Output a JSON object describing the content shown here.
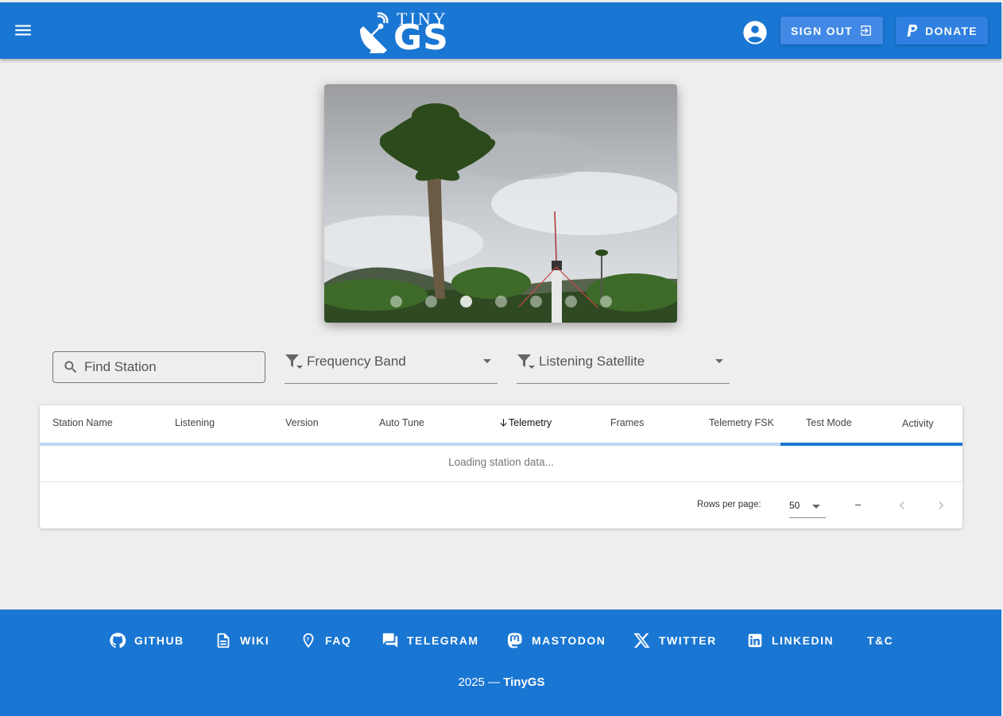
{
  "header": {
    "logo_top": "TINY",
    "logo_main": "GS",
    "sign_out_label": "SIGN OUT",
    "donate_label": "DONATE"
  },
  "carousel": {
    "slide_count": 7,
    "active_slide": 3
  },
  "filters": {
    "search_placeholder": "Find Station",
    "frequency_band_label": "Frequency Band",
    "listening_satellite_label": "Listening Satellite"
  },
  "table": {
    "columns": [
      {
        "label": "Station Name"
      },
      {
        "label": "Listening"
      },
      {
        "label": "Version"
      },
      {
        "label": "Auto Tune"
      },
      {
        "label": "Telemetry",
        "sorted": "desc"
      },
      {
        "label": "Frames"
      },
      {
        "label": "Telemetry FSK"
      },
      {
        "label": "Test Mode"
      },
      {
        "label": "Activity"
      }
    ],
    "loading_text": "Loading station data...",
    "rows_per_page_label": "Rows per page:",
    "rows_per_page_value": "50",
    "range_text": "–"
  },
  "footer": {
    "links": [
      {
        "label": "GITHUB",
        "icon": "github-icon"
      },
      {
        "label": "WIKI",
        "icon": "document-icon"
      },
      {
        "label": "FAQ",
        "icon": "help-location-icon"
      },
      {
        "label": "TELEGRAM",
        "icon": "chat-icon"
      },
      {
        "label": "MASTODON",
        "icon": "mastodon-icon"
      },
      {
        "label": "TWITTER",
        "icon": "x-icon"
      },
      {
        "label": "LINKEDIN",
        "icon": "linkedin-icon"
      },
      {
        "label": "T&C",
        "icon": ""
      }
    ],
    "copyright_prefix": "2025 —",
    "copyright_brand": "TinyGS"
  },
  "colors": {
    "primary": "#1976d2",
    "background": "#eeeeee",
    "progress_track": "#bdd6f3"
  }
}
